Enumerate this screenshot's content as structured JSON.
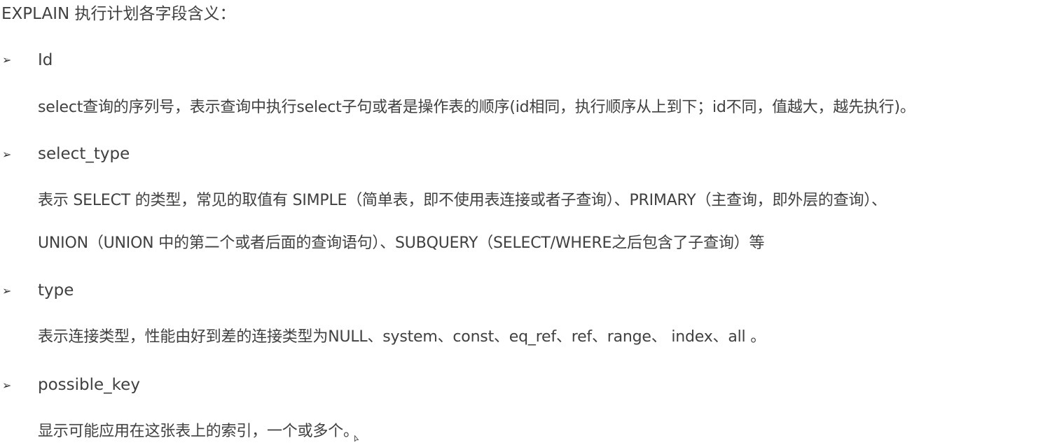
{
  "heading": "EXPLAIN 执行计划各字段含义：",
  "bullet_glyph": "➢",
  "sections": [
    {
      "name": "Id",
      "lines": [
        "select查询的序列号，表示查询中执行select子句或者是操作表的顺序(id相同，执行顺序从上到下；id不同，值越大，越先执行)。"
      ]
    },
    {
      "name": "select_type",
      "lines": [
        "表示 SELECT 的类型，常见的取值有 SIMPLE（简单表，即不使用表连接或者子查询）、PRIMARY（主查询，即外层的查询）、",
        "UNION（UNION 中的第二个或者后面的查询语句）、SUBQUERY（SELECT/WHERE之后包含了子查询）等"
      ]
    },
    {
      "name": "type",
      "lines": [
        "表示连接类型，性能由好到差的连接类型为NULL、system、const、eq_ref、ref、range、 index、all 。"
      ]
    },
    {
      "name": "possible_key",
      "lines": [
        "显示可能应用在这张表上的索引，一个或多个。"
      ]
    }
  ]
}
